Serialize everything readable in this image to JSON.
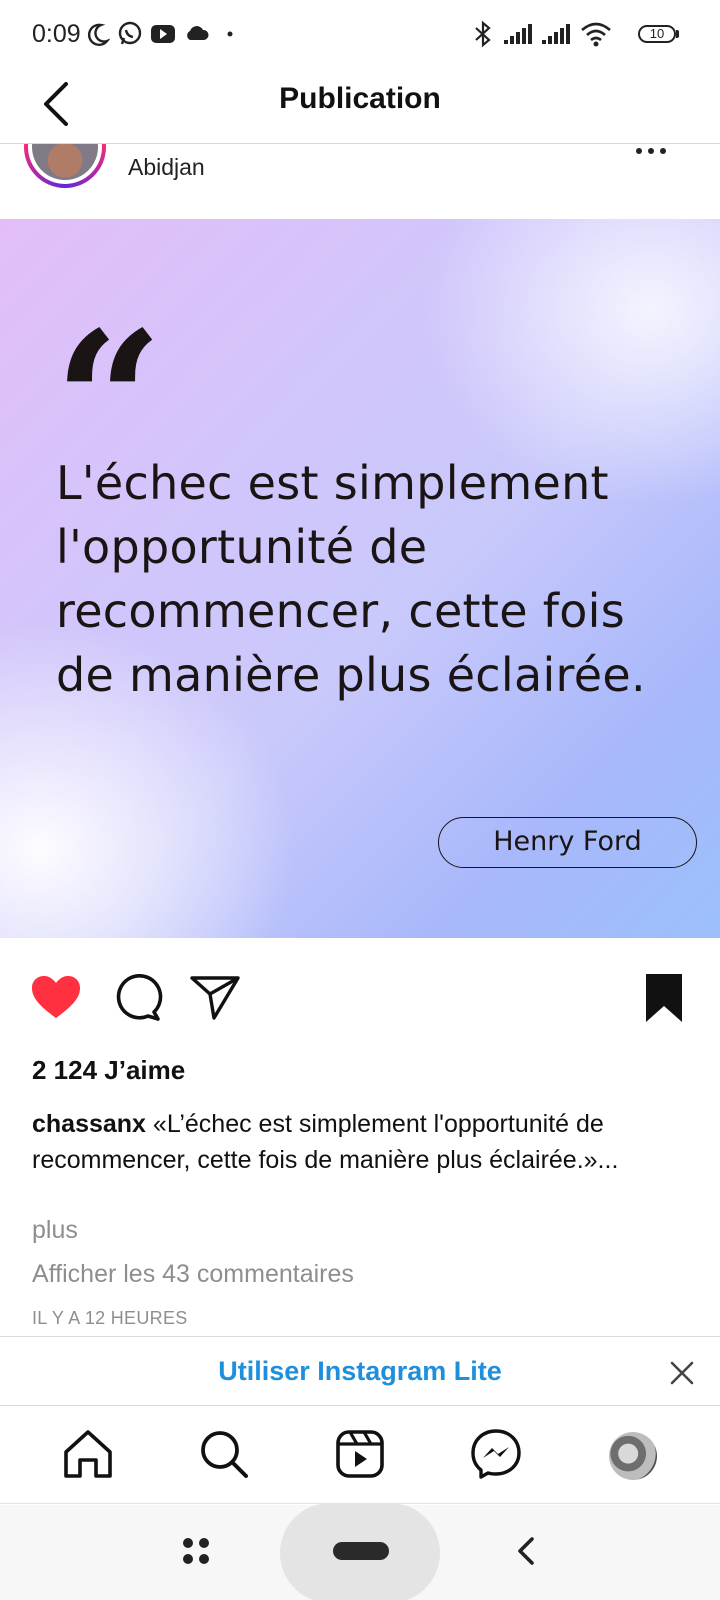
{
  "status_bar": {
    "time": "0:09",
    "battery_level": "10",
    "icons": [
      "moon-icon",
      "whatsapp-icon",
      "youtube-icon",
      "cloud-icon",
      "dot-icon",
      "bluetooth-icon",
      "signal-icon",
      "signal-icon",
      "wifi-icon",
      "battery-icon"
    ]
  },
  "header": {
    "title": "Publication",
    "back_icon": "chevron-left-icon"
  },
  "post": {
    "location": "Abidjan",
    "quote_mark": "“",
    "quote_text": "L'échec est simplement l'opportunité de recommencer, cette fois de manière plus éclairée.",
    "author": "Henry Ford",
    "liked": true,
    "saved": true,
    "likes": "2 124 J’aime",
    "caption_user": "chassanx",
    "caption_text": " «L’échec est simplement l'opportunité de recommencer, cette fois de manière plus éclairée.»...",
    "more_label": "plus",
    "comments_label": "Afficher les 43 commentaires",
    "timestamp": "IL Y A 12 HEURES"
  },
  "lite_banner": {
    "label": "Utiliser Instagram Lite"
  },
  "bottom_nav": {
    "items": [
      "home-icon",
      "search-icon",
      "reels-icon",
      "messenger-icon",
      "profile-avatar"
    ]
  },
  "colors": {
    "like_red": "#ff3040",
    "link_blue": "#1f8fdd",
    "muted_gray": "#8e8e8e"
  }
}
